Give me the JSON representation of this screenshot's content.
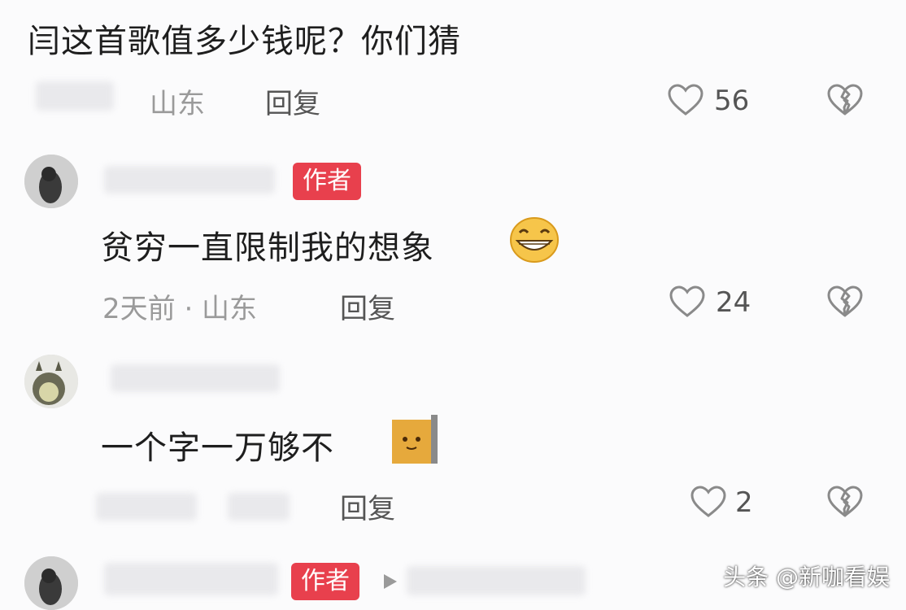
{
  "comments": [
    {
      "text": "闫这首歌值多少钱呢？你们猜",
      "meta": "山东",
      "reply_label": "回复",
      "likes": "56"
    },
    {
      "badge": "作者",
      "text": "贫穷一直限制我的想象",
      "meta": "2天前 · 山东",
      "reply_label": "回复",
      "likes": "24",
      "emoji": "grinning-face-icon"
    },
    {
      "text": "一个字一万够不",
      "reply_label": "回复",
      "likes": "2",
      "emoji": "cat-face-icon"
    },
    {
      "badge": "作者"
    }
  ],
  "watermark": "头条 @新咖看娱",
  "colors": {
    "badge": "#e8404d",
    "icon": "#8a8a8a",
    "background": "#fbfbfc"
  }
}
